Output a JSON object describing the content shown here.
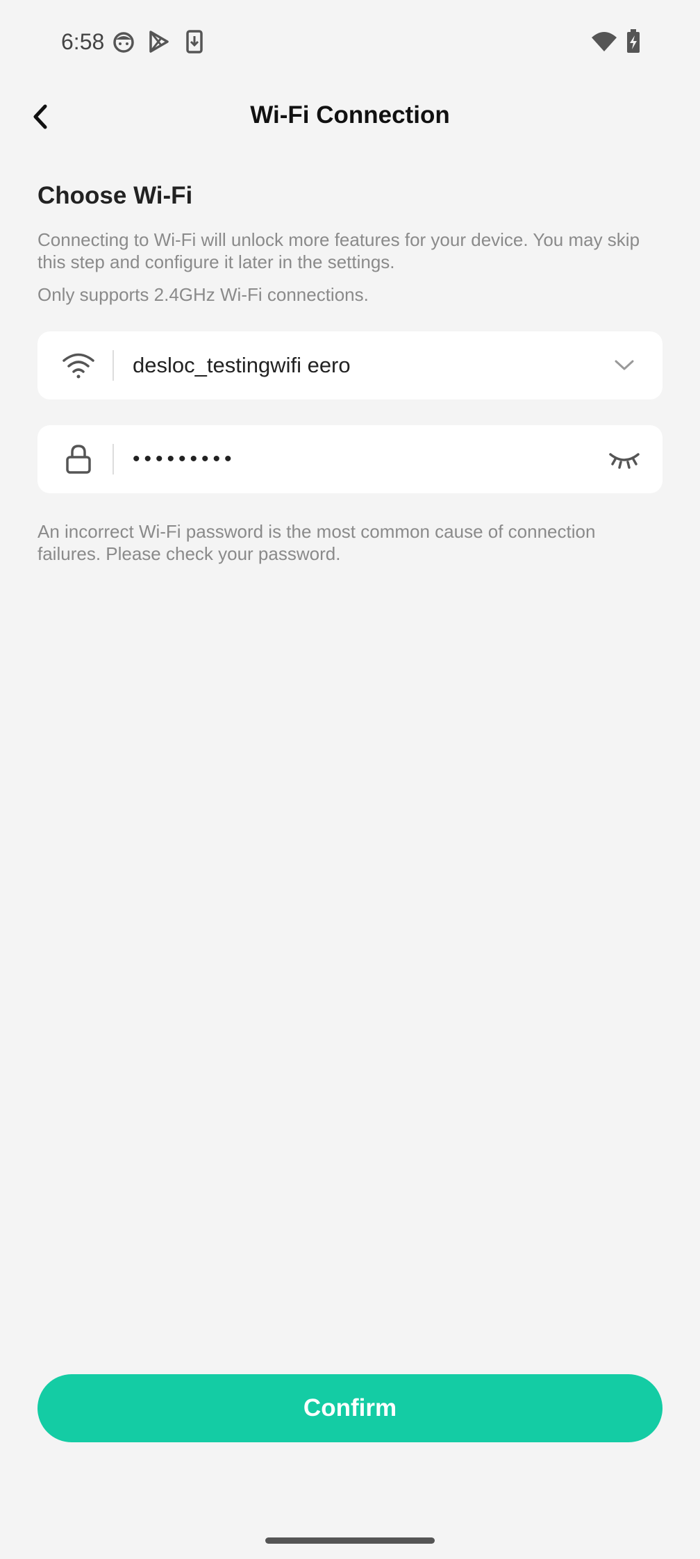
{
  "status_bar": {
    "time": "6:58",
    "icons_left": [
      "face-notification-icon",
      "play-store-icon",
      "download-icon"
    ],
    "icons_right": [
      "wifi-signal-icon",
      "battery-charging-icon"
    ]
  },
  "header": {
    "title": "Wi-Fi Connection",
    "back_icon": "chevron-left-icon"
  },
  "section": {
    "title": "Choose Wi-Fi",
    "description": "Connecting to Wi-Fi will unlock more features for your device. You may skip this step and configure it later in the settings.",
    "note": "Only supports 2.4GHz Wi-Fi connections."
  },
  "wifi_field": {
    "icon": "wifi-icon",
    "value": "desloc_testingwifi eero",
    "action_icon": "chevron-down-icon"
  },
  "password_field": {
    "icon": "lock-icon",
    "value": "•••••••••",
    "action_icon": "eye-closed-icon"
  },
  "hint": "An incorrect Wi-Fi password is the most common cause of connection failures. Please check your password.",
  "confirm_label": "Confirm",
  "colors": {
    "accent": "#14cca4",
    "background": "#f4f4f4",
    "field_background": "#ffffff",
    "muted_text": "#8a8a8a"
  }
}
